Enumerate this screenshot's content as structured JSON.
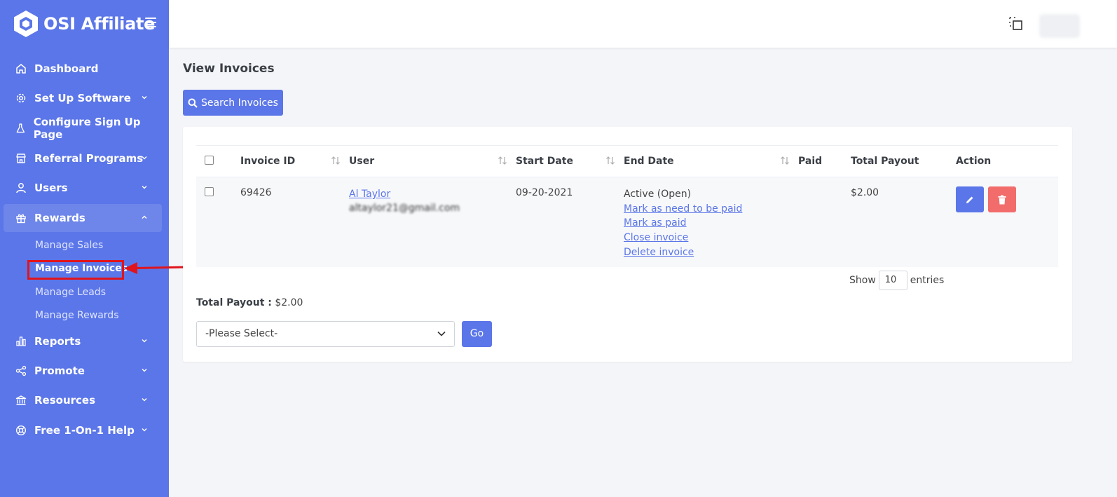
{
  "brand": {
    "name": "OSI Affiliate"
  },
  "sidebar": {
    "items": [
      {
        "label": "Dashboard",
        "icon": "home-icon"
      },
      {
        "label": "Set Up Software",
        "icon": "gear-icon"
      },
      {
        "label": "Configure Sign Up Page",
        "icon": "flask-icon"
      },
      {
        "label": "Referral Programs",
        "icon": "store-icon"
      },
      {
        "label": "Users",
        "icon": "user-icon"
      },
      {
        "label": "Rewards",
        "icon": "gift-icon"
      },
      {
        "label": "Reports",
        "icon": "bar-chart-icon"
      },
      {
        "label": "Promote",
        "icon": "share-icon"
      },
      {
        "label": "Resources",
        "icon": "bank-icon"
      },
      {
        "label": "Free 1-On-1 Help",
        "icon": "lifebuoy-icon"
      }
    ],
    "rewards_sub": [
      {
        "label": "Manage Sales"
      },
      {
        "label": "Manage Invoices"
      },
      {
        "label": "Manage Leads"
      },
      {
        "label": "Manage Rewards"
      }
    ]
  },
  "page": {
    "title": "View Invoices",
    "search_button": "Search Invoices"
  },
  "table": {
    "headers": [
      "Invoice ID",
      "User",
      "Start Date",
      "End Date",
      "Paid",
      "Total Payout",
      "Action"
    ],
    "rows": [
      {
        "invoice_id": "69426",
        "user_name": "Al Taylor",
        "user_email": "altaylor21@gmail.com",
        "start_date": "09-20-2021",
        "status": "Active (Open)",
        "links": [
          "Mark as need to be paid",
          "Mark as paid",
          "Close invoice",
          "Delete invoice"
        ],
        "paid": "",
        "total_payout": "$2.00"
      }
    ]
  },
  "footer": {
    "show_label": "Show",
    "entries_value": "10",
    "entries_label": "entries",
    "total_payout_label": "Total Payout :",
    "total_payout_value": "$2.00",
    "select_placeholder": "-Please Select-",
    "go_label": "Go"
  },
  "colors": {
    "accent": "#5b76e8",
    "danger": "#f26c6c",
    "annotation": "#e0141c"
  }
}
